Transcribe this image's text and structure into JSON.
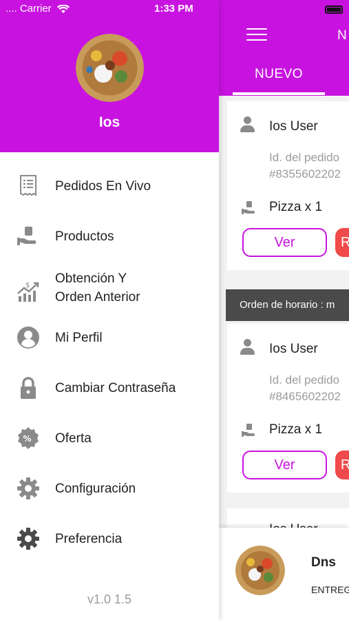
{
  "status_bar": {
    "carrier": "Carrier",
    "time": "1:33 PM"
  },
  "drawer": {
    "user_name": "Ios",
    "menu": [
      {
        "label": "Pedidos En Vivo",
        "icon": "receipt-icon"
      },
      {
        "label": "Productos",
        "icon": "hand-bag-icon"
      },
      {
        "label": "Obtención Y",
        "label2": "Orden Anterior",
        "icon": "growth-chart-icon"
      },
      {
        "label": "Mi Perfil",
        "icon": "profile-icon"
      },
      {
        "label": "Cambiar Contraseña",
        "icon": "lock-icon"
      },
      {
        "label": "Oferta",
        "icon": "percent-badge-icon"
      },
      {
        "label": "Configuración",
        "icon": "gear-icon"
      },
      {
        "label": "Preferencia",
        "icon": "gear-icon"
      }
    ],
    "version": "v1.0 1.5"
  },
  "main": {
    "header_title": "N",
    "tab_label": "NUEVO",
    "orders": [
      {
        "user": "Ios User",
        "order_label": "Id. del pedido",
        "order_id": "#8355602202",
        "item": "Pizza x 1",
        "view_button": "Ver",
        "reject_button": "R"
      },
      {
        "user": "Ios User",
        "order_label": "Id. del pedido",
        "order_id": "#8465602202",
        "item": "Pizza x 1",
        "view_button": "Ver",
        "reject_button": "R"
      }
    ],
    "schedule_label": "Orden de horario : m",
    "peek_user": "Ios User",
    "bottom": {
      "name": "Dns",
      "status": "ENTREG"
    }
  },
  "colors": {
    "accent": "#c813e0",
    "reject": "#f04a4a",
    "schedule_bar": "#4a4a4a",
    "text_muted": "#9b9b9b"
  }
}
